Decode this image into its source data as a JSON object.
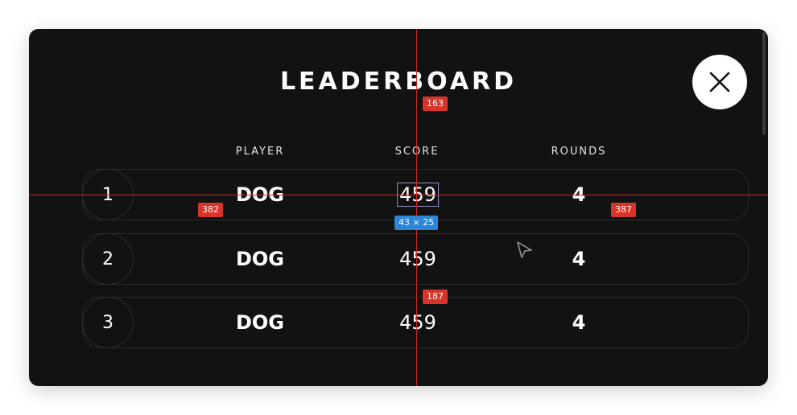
{
  "title": "LEADERBOARD",
  "close_icon": "close-icon",
  "columns": {
    "player": "PLAYER",
    "score": "SCORE",
    "rounds": "ROUNDS"
  },
  "rows": [
    {
      "rank": "1",
      "player": "DOG",
      "score": "459",
      "rounds": "4"
    },
    {
      "rank": "2",
      "player": "DOG",
      "score": "459",
      "rounds": "4"
    },
    {
      "rank": "3",
      "player": "DOG",
      "score": "459",
      "rounds": "4"
    }
  ],
  "overlay": {
    "badge_top": "163",
    "badge_left": "382",
    "badge_right": "387",
    "badge_bottom": "187",
    "size_label": "43 × 25"
  },
  "colors": {
    "background": "#121212",
    "text": "#ffffff",
    "guide": "#d12a1f",
    "badge_red": "#d8342a",
    "badge_blue": "#2b86d9"
  }
}
